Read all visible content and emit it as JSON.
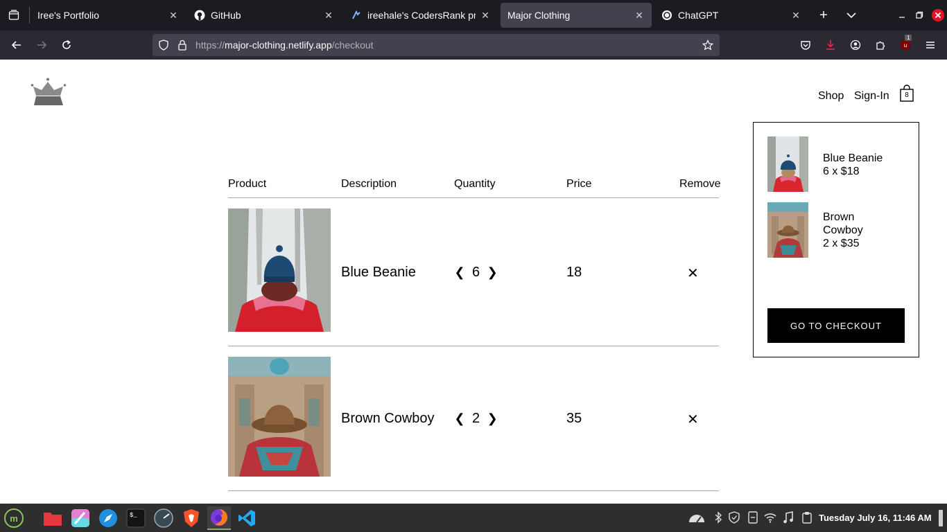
{
  "browser": {
    "tabs": [
      {
        "title": "Iree's Portfolio",
        "favicon": "blank"
      },
      {
        "title": "GitHub",
        "favicon": "github-icon"
      },
      {
        "title": "ireehale's CodersRank profi",
        "favicon": "codersrank-icon"
      },
      {
        "title": "Major Clothing",
        "favicon": "blank"
      },
      {
        "title": "ChatGPT",
        "favicon": "chatgpt-icon"
      }
    ],
    "active_tab": 3,
    "url_scheme": "https://",
    "url_host": "major-clothing.netlify.app",
    "url_path": "/checkout",
    "extension_badge": "1"
  },
  "site": {
    "nav": {
      "shop": "Shop",
      "signin": "Sign-In",
      "cart_count": "8"
    },
    "cart_dropdown": {
      "items": [
        {
          "name": "Blue Beanie",
          "qty_price": "6 x $18"
        },
        {
          "name_line1": "Brown",
          "name_line2": "Cowboy",
          "qty_price": "2 x $35"
        }
      ],
      "button": "GO TO CHECKOUT"
    },
    "checkout": {
      "headers": [
        "Product",
        "Description",
        "Quantity",
        "Price",
        "Remove"
      ],
      "rows": [
        {
          "name": "Blue Beanie",
          "quantity": "6",
          "price": "18",
          "remove": "✕"
        },
        {
          "name": "Brown Cowboy",
          "quantity": "2",
          "price": "35",
          "remove": "✕"
        }
      ],
      "dec_arrow": "❮",
      "inc_arrow": "❯"
    }
  },
  "taskbar": {
    "clock": "Tuesday July 16, 11:46 AM"
  },
  "colors": {
    "tabbar_bg": "#1c1b22",
    "navbar_bg": "#2b2a33",
    "urlbar_bg": "#42414d",
    "taskbar_bg": "#2e2e2e",
    "close_window": "#e81123"
  }
}
